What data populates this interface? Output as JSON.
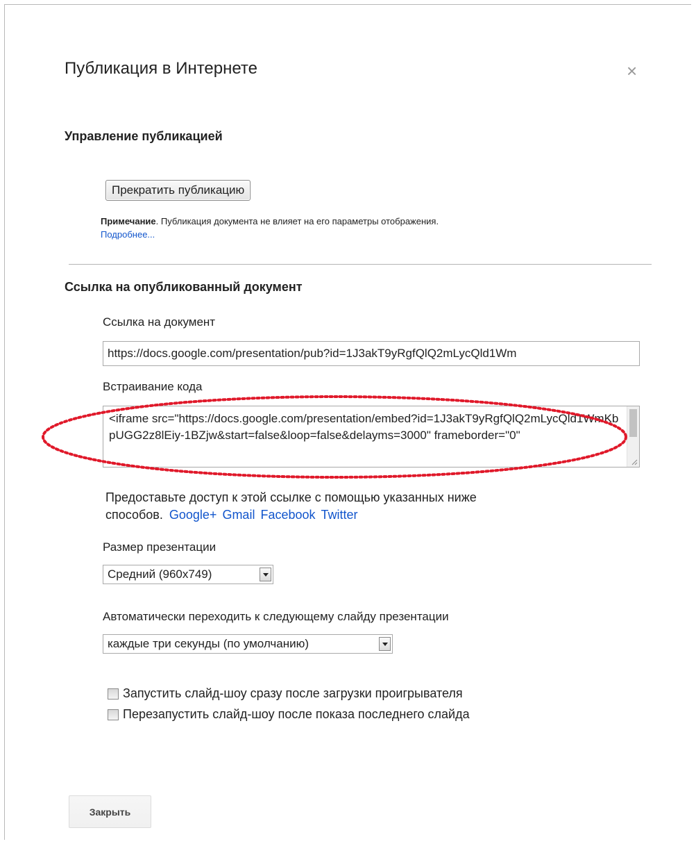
{
  "dialog": {
    "title": "Публикация в Интернете",
    "close_glyph": "×"
  },
  "manage": {
    "heading": "Управление публикацией",
    "stop_button": "Прекратить публикацию",
    "note_bold": "Примечание",
    "note_text": ". Публикация документа не влияет на его параметры отображения.",
    "more_link": "Подробнее..."
  },
  "published": {
    "heading": "Ссылка на опубликованный документ",
    "link_label": "Ссылка на документ",
    "link_value": "https://docs.google.com/presentation/pub?id=1J3akT9yRgfQlQ2mLycQld1Wm",
    "embed_label": "Встраивание кода",
    "embed_value": "<iframe src=\"https://docs.google.com/presentation/embed?id=1J3akT9yRgfQlQ2mLycQld1WmKbpUGG2z8lEiy-1BZjw&start=false&loop=false&delayms=3000\" frameborder=\"0\"",
    "share_text_1": "Предоставьте доступ к этой ссылке с помощью указанных ниже",
    "share_text_2": "способов.",
    "share_links": [
      "Google+",
      "Gmail",
      "Facebook",
      "Twitter"
    ],
    "size_label": "Размер презентации",
    "size_selected": "Средний (960x749)",
    "advance_label": "Автоматически переходить к следующему слайду презентации",
    "advance_selected": "каждые три секунды (по умолчанию)",
    "checkbox_start": "Запустить слайд-шоу сразу после загрузки проигрывателя",
    "checkbox_restart": "Перезапустить слайд-шоу после показа последнего слайда",
    "checkbox_start_checked": false,
    "checkbox_restart_checked": false
  },
  "footer": {
    "close_button": "Закрыть"
  },
  "colors": {
    "link": "#1155cc",
    "highlight": "#e0192a",
    "divider": "#b5b5b5"
  },
  "icons": {
    "close": "close-icon",
    "dropdown": "chevron-down-icon",
    "resize": "resize-grip-icon"
  }
}
